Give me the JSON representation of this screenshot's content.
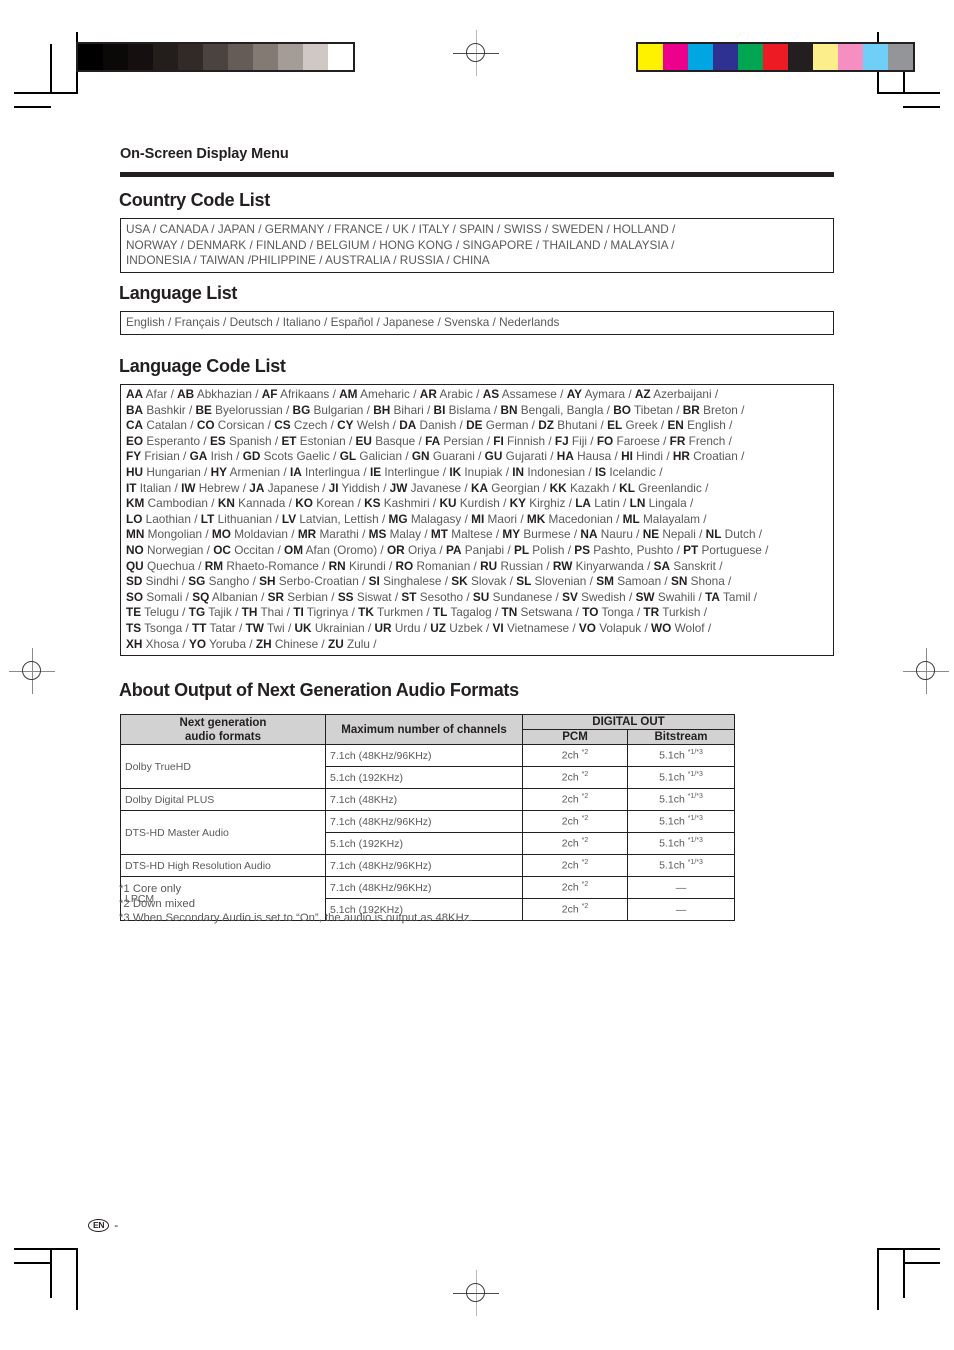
{
  "running_head": "On-Screen Display Menu",
  "sections": {
    "country": {
      "title": "Country Code List",
      "lines": [
        "USA / CANADA / JAPAN / GERMANY / FRANCE / UK / ITALY / SPAIN / SWISS / SWEDEN / HOLLAND /",
        "NORWAY / DENMARK / FINLAND / BELGIUM / HONG KONG / SINGAPORE / THAILAND / MALAYSIA /",
        "INDONESIA / TAIWAN /PHILIPPINE / AUSTRALIA / RUSSIA / CHINA"
      ]
    },
    "language": {
      "title": "Language List",
      "lines": [
        "English / Français / Deutsch / Italiano / Español / Japanese / Svenska / Nederlands"
      ]
    },
    "language_code": {
      "title": "Language Code List",
      "rows": [
        [
          [
            "AA",
            "Afar"
          ],
          [
            "AB",
            "Abkhazian"
          ],
          [
            "AF",
            "Afrikaans"
          ],
          [
            "AM",
            "Ameharic"
          ],
          [
            "AR",
            "Arabic"
          ],
          [
            "AS",
            "Assamese"
          ],
          [
            "AY",
            "Aymara"
          ],
          [
            "AZ",
            "Azerbaijani"
          ]
        ],
        [
          [
            "BA",
            "Bashkir"
          ],
          [
            "BE",
            "Byelorussian"
          ],
          [
            "BG",
            "Bulgarian"
          ],
          [
            "BH",
            "Bihari"
          ],
          [
            "BI",
            "Bislama"
          ],
          [
            "BN",
            "Bengali, Bangla"
          ],
          [
            "BO",
            "Tibetan"
          ],
          [
            "BR",
            "Breton"
          ]
        ],
        [
          [
            "CA",
            "Catalan"
          ],
          [
            "CO",
            "Corsican"
          ],
          [
            "CS",
            "Czech"
          ],
          [
            "CY",
            "Welsh"
          ],
          [
            "DA",
            "Danish"
          ],
          [
            "DE",
            "German"
          ],
          [
            "DZ",
            "Bhutani"
          ],
          [
            "EL",
            "Greek"
          ],
          [
            "EN",
            "English"
          ]
        ],
        [
          [
            "EO",
            "Esperanto"
          ],
          [
            "ES",
            "Spanish"
          ],
          [
            "ET",
            "Estonian"
          ],
          [
            "EU",
            "Basque"
          ],
          [
            "FA",
            "Persian"
          ],
          [
            "FI",
            "Finnish"
          ],
          [
            "FJ",
            "Fiji"
          ],
          [
            "FO",
            "Faroese"
          ],
          [
            "FR",
            "French"
          ]
        ],
        [
          [
            "FY",
            "Frisian"
          ],
          [
            "GA",
            "Irish"
          ],
          [
            "GD",
            "Scots Gaelic"
          ],
          [
            "GL",
            "Galician"
          ],
          [
            "GN",
            "Guarani"
          ],
          [
            "GU",
            "Gujarati"
          ],
          [
            "HA",
            "Hausa"
          ],
          [
            "HI",
            "Hindi"
          ],
          [
            "HR",
            "Croatian"
          ]
        ],
        [
          [
            "HU",
            "Hungarian"
          ],
          [
            "HY",
            "Armenian"
          ],
          [
            "IA",
            "Interlingua"
          ],
          [
            "IE",
            "Interlingue"
          ],
          [
            "IK",
            "Inupiak"
          ],
          [
            "IN",
            "Indonesian"
          ],
          [
            "IS",
            "Icelandic"
          ]
        ],
        [
          [
            "IT",
            "Italian"
          ],
          [
            "IW",
            "Hebrew"
          ],
          [
            "JA",
            "Japanese"
          ],
          [
            "JI",
            "Yiddish"
          ],
          [
            "JW",
            "Javanese"
          ],
          [
            "KA",
            "Georgian"
          ],
          [
            "KK",
            "Kazakh"
          ],
          [
            "KL",
            "Greenlandic"
          ]
        ],
        [
          [
            "KM",
            "Cambodian"
          ],
          [
            "KN",
            "Kannada"
          ],
          [
            "KO",
            "Korean"
          ],
          [
            "KS",
            "Kashmiri"
          ],
          [
            "KU",
            "Kurdish"
          ],
          [
            "KY",
            "Kirghiz"
          ],
          [
            "LA",
            "Latin"
          ],
          [
            "LN",
            "Lingala"
          ]
        ],
        [
          [
            "LO",
            "Laothian"
          ],
          [
            "LT",
            "Lithuanian"
          ],
          [
            "LV",
            "Latvian, Lettish"
          ],
          [
            "MG",
            "Malagasy"
          ],
          [
            "MI",
            "Maori"
          ],
          [
            "MK",
            "Macedonian"
          ],
          [
            "ML",
            "Malayalam"
          ]
        ],
        [
          [
            "MN",
            "Mongolian"
          ],
          [
            "MO",
            "Moldavian"
          ],
          [
            "MR",
            "Marathi"
          ],
          [
            "MS",
            "Malay"
          ],
          [
            "MT",
            "Maltese"
          ],
          [
            "MY",
            "Burmese"
          ],
          [
            "NA",
            "Nauru"
          ],
          [
            "NE",
            "Nepali"
          ],
          [
            "NL",
            "Dutch"
          ]
        ],
        [
          [
            "NO",
            "Norwegian"
          ],
          [
            "OC",
            "Occitan"
          ],
          [
            "OM",
            "Afan (Oromo)"
          ],
          [
            "OR",
            "Oriya"
          ],
          [
            "PA",
            "Panjabi"
          ],
          [
            "PL",
            "Polish"
          ],
          [
            "PS",
            "Pashto, Pushto"
          ],
          [
            "PT",
            "Portuguese"
          ]
        ],
        [
          [
            "QU",
            "Quechua"
          ],
          [
            "RM",
            "Rhaeto-Romance"
          ],
          [
            "RN",
            "Kirundi"
          ],
          [
            "RO",
            "Romanian"
          ],
          [
            "RU",
            "Russian"
          ],
          [
            "RW",
            "Kinyarwanda"
          ],
          [
            "SA",
            "Sanskrit"
          ]
        ],
        [
          [
            "SD",
            "Sindhi"
          ],
          [
            "SG",
            "Sangho"
          ],
          [
            "SH",
            "Serbo-Croatian"
          ],
          [
            "SI",
            "Singhalese"
          ],
          [
            "SK",
            "Slovak"
          ],
          [
            "SL",
            "Slovenian"
          ],
          [
            "SM",
            "Samoan"
          ],
          [
            "SN",
            "Shona"
          ]
        ],
        [
          [
            "SO",
            "Somali"
          ],
          [
            "SQ",
            "Albanian"
          ],
          [
            "SR",
            "Serbian"
          ],
          [
            "SS",
            "Siswat"
          ],
          [
            "ST",
            "Sesotho"
          ],
          [
            "SU",
            "Sundanese"
          ],
          [
            "SV",
            "Swedish"
          ],
          [
            "SW",
            "Swahili"
          ],
          [
            "TA",
            "Tamil"
          ]
        ],
        [
          [
            "TE",
            "Telugu"
          ],
          [
            "TG",
            "Tajik"
          ],
          [
            "TH",
            "Thai"
          ],
          [
            "TI",
            "Tigrinya"
          ],
          [
            "TK",
            "Turkmen"
          ],
          [
            "TL",
            "Tagalog"
          ],
          [
            "TN",
            "Setswana"
          ],
          [
            "TO",
            "Tonga"
          ],
          [
            "TR",
            "Turkish"
          ]
        ],
        [
          [
            "TS",
            "Tsonga"
          ],
          [
            "TT",
            "Tatar"
          ],
          [
            "TW",
            "Twi"
          ],
          [
            "UK",
            "Ukrainian"
          ],
          [
            "UR",
            "Urdu"
          ],
          [
            "UZ",
            "Uzbek"
          ],
          [
            "VI",
            "Vietnamese"
          ],
          [
            "VO",
            "Volapuk"
          ],
          [
            "WO",
            "Wolof"
          ]
        ],
        [
          [
            "XH",
            "Xhosa"
          ],
          [
            "YO",
            "Yoruba"
          ],
          [
            "ZH",
            "Chinese"
          ],
          [
            "ZU",
            "Zulu"
          ]
        ]
      ]
    },
    "audio": {
      "title": "About Output of Next Generation Audio Formats",
      "headers": {
        "format": "Next generation\naudio formats",
        "format_line1": "Next generation",
        "format_line2": "audio formats",
        "max_channels": "Maximum number of channels",
        "digital_out": "DIGITAL OUT",
        "pcm": "PCM",
        "bitstream": "Bitstream"
      },
      "rows": [
        {
          "format": "Dolby TrueHD",
          "entries": [
            {
              "max": "7.1ch (48KHz/96KHz)",
              "pcm": "2ch",
              "pcm_note": "*2",
              "bitstream": "5.1ch",
              "bitstream_note": "*1/*3"
            },
            {
              "max": "5.1ch (192KHz)",
              "pcm": "2ch",
              "pcm_note": "*2",
              "bitstream": "5.1ch",
              "bitstream_note": "*1/*3"
            }
          ]
        },
        {
          "format": "Dolby Digital PLUS",
          "entries": [
            {
              "max": "7.1ch (48KHz)",
              "pcm": "2ch",
              "pcm_note": "*2",
              "bitstream": "5.1ch",
              "bitstream_note": "*1/*3"
            }
          ]
        },
        {
          "format": "DTS-HD Master Audio",
          "entries": [
            {
              "max": "7.1ch (48KHz/96KHz)",
              "pcm": "2ch",
              "pcm_note": "*2",
              "bitstream": "5.1ch",
              "bitstream_note": "*1/*3"
            },
            {
              "max": "5.1ch (192KHz)",
              "pcm": "2ch",
              "pcm_note": "*2",
              "bitstream": "5.1ch",
              "bitstream_note": "*1/*3"
            }
          ]
        },
        {
          "format": "DTS-HD High Resolution Audio",
          "entries": [
            {
              "max": "7.1ch (48KHz/96KHz)",
              "pcm": "2ch",
              "pcm_note": "*2",
              "bitstream": "5.1ch",
              "bitstream_note": "*1/*3"
            }
          ]
        },
        {
          "format": "LPCM",
          "entries": [
            {
              "max": "7.1ch (48KHz/96KHz)",
              "pcm": "2ch",
              "pcm_note": "*2",
              "bitstream": "—",
              "bitstream_note": ""
            },
            {
              "max": "5.1ch (192KHz)",
              "pcm": "2ch",
              "pcm_note": "*2",
              "bitstream": "—",
              "bitstream_note": ""
            }
          ]
        }
      ],
      "footnotes": [
        "*1 Core only",
        "*2 Down mixed",
        "*3 When Secondary Audio is set to “On”, the audio is output as 48KHz."
      ]
    }
  },
  "footer": {
    "language_badge": "EN",
    "dash": "-"
  },
  "print_marks": {
    "gray_strip": [
      "#000000",
      "#0b0808",
      "#15100f",
      "#231d1b",
      "#312a27",
      "#4b433f",
      "#655c57",
      "#837a74",
      "#a49c97",
      "#cfc8c4",
      "#ffffff"
    ],
    "color_strip": [
      "#fff200",
      "#ec008c",
      "#00a6e2",
      "#2e3192",
      "#00a651",
      "#ed1c24",
      "#231f20",
      "#fcee8a",
      "#f58fc2",
      "#6fcff6",
      "#939598"
    ]
  }
}
